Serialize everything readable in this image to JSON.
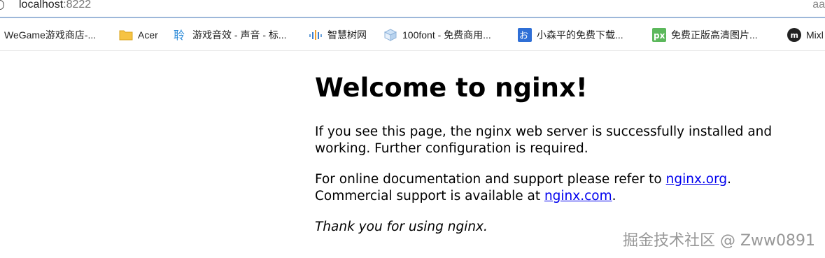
{
  "address_bar": {
    "host": "localhost",
    "port": ":8222",
    "right_fragment": "aa"
  },
  "bookmarks": [
    {
      "label": "WeGame游戏商店-...",
      "icon": "none"
    },
    {
      "label": "Acer",
      "icon": "folder-icon"
    },
    {
      "label": "游戏音效 - 声音 - 标...",
      "icon": "sound-site-icon"
    },
    {
      "label": "智慧树网",
      "icon": "wave-bars-icon"
    },
    {
      "label": "100font - 免费商用...",
      "icon": "cube-icon"
    },
    {
      "label": "小森平的免费下载...",
      "icon": "blue-square-icon"
    },
    {
      "label": "免费正版高清图片...",
      "icon": "px-icon"
    },
    {
      "label": "Mixl",
      "icon": "m-circle-icon"
    }
  ],
  "page": {
    "heading": "Welcome to nginx!",
    "para1_line1": "If you see this page, the nginx web server is successfully installed and",
    "para1_line2": "working. Further configuration is required.",
    "para2_line1_before": "For online documentation and support please refer to ",
    "para2_link1": "nginx.org",
    "para2_line1_after": ".",
    "para2_line2_before": "Commercial support is available at ",
    "para2_link2": "nginx.com",
    "para2_line2_after": ".",
    "para3": "Thank you for using nginx."
  },
  "watermark": "掘金技术社区 @ Zww0891",
  "colors": {
    "link": "#0000ee",
    "address_border": "#9db7d9",
    "px_green": "#5cb85c",
    "blue_square": "#2f6fd6"
  }
}
